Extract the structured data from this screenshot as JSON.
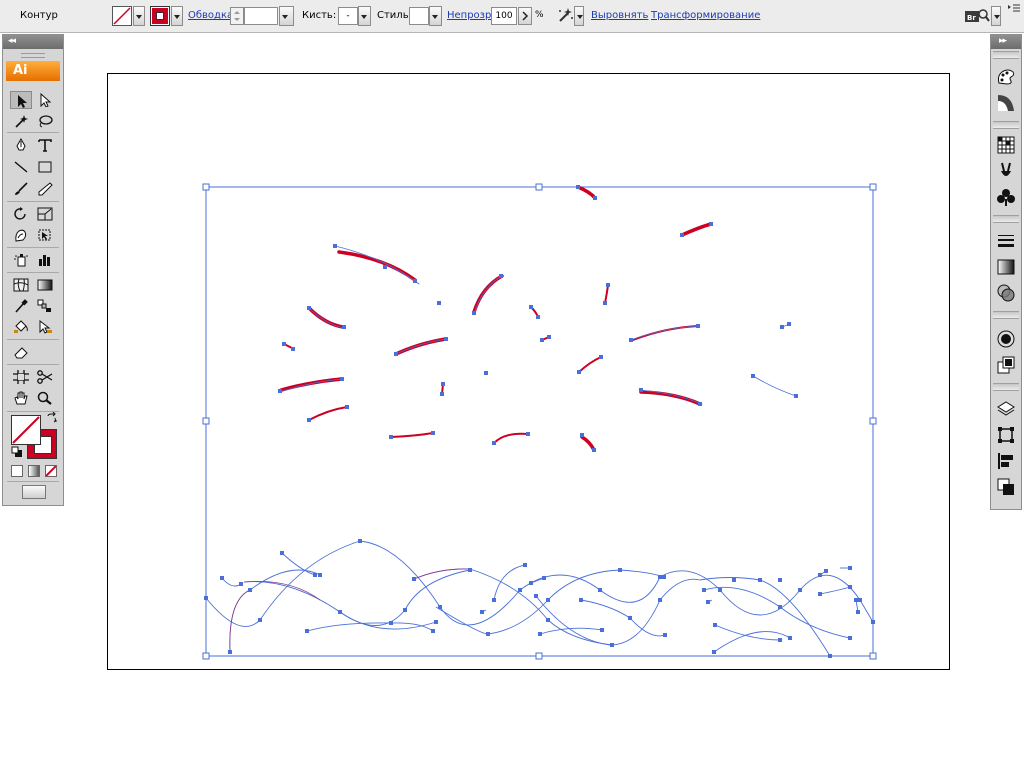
{
  "control_bar": {
    "mode_label": "Контур",
    "stroke_link": "Обводка:",
    "brush_label": "Кисть:",
    "brush_value": "-",
    "style_label": "Стиль:",
    "opacity_link": "Непрозр.:",
    "opacity_value": "100",
    "opacity_unit": "%",
    "align_link": "Выровнять",
    "transform_link": "Трансформирование",
    "bridge_label": "Br"
  },
  "tools_panel": {
    "logo": "Ai",
    "collapse_glyph": "◂◂"
  },
  "right_dock": {
    "collapse_glyph": "▸▸"
  },
  "colors": {
    "stroke_red": "#cc0022",
    "selection_blue": "#4a6fd8",
    "path_purple": "#6a4a9a",
    "accent_orange": "#f08a00"
  }
}
